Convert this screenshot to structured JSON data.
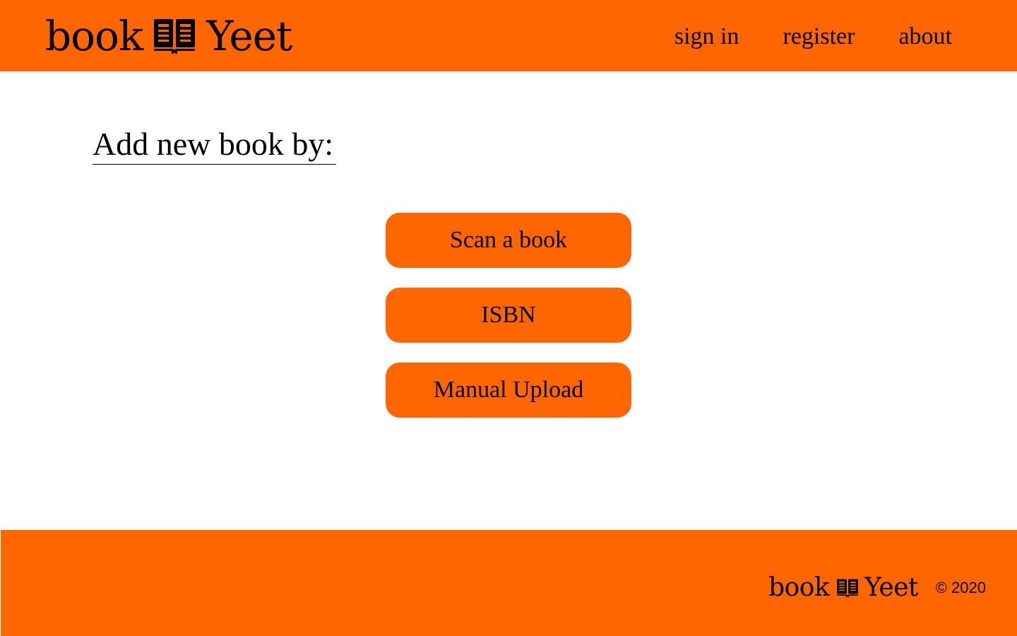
{
  "header": {
    "logo": {
      "left_text": "book",
      "right_text": "Yeet",
      "icon": "book-open-icon"
    },
    "nav": {
      "sign_in": "sign in",
      "register": "register",
      "about": "about"
    }
  },
  "main": {
    "heading": "Add new book by:",
    "buttons": {
      "scan": "Scan a book",
      "isbn": "ISBN",
      "manual": "Manual Upload"
    }
  },
  "footer": {
    "logo": {
      "left_text": "book",
      "right_text": "Yeet",
      "icon": "book-open-icon"
    },
    "copyright": "© 2020"
  },
  "colors": {
    "brand_orange": "#ff6600",
    "background": "#ffffff",
    "text": "#000000"
  }
}
